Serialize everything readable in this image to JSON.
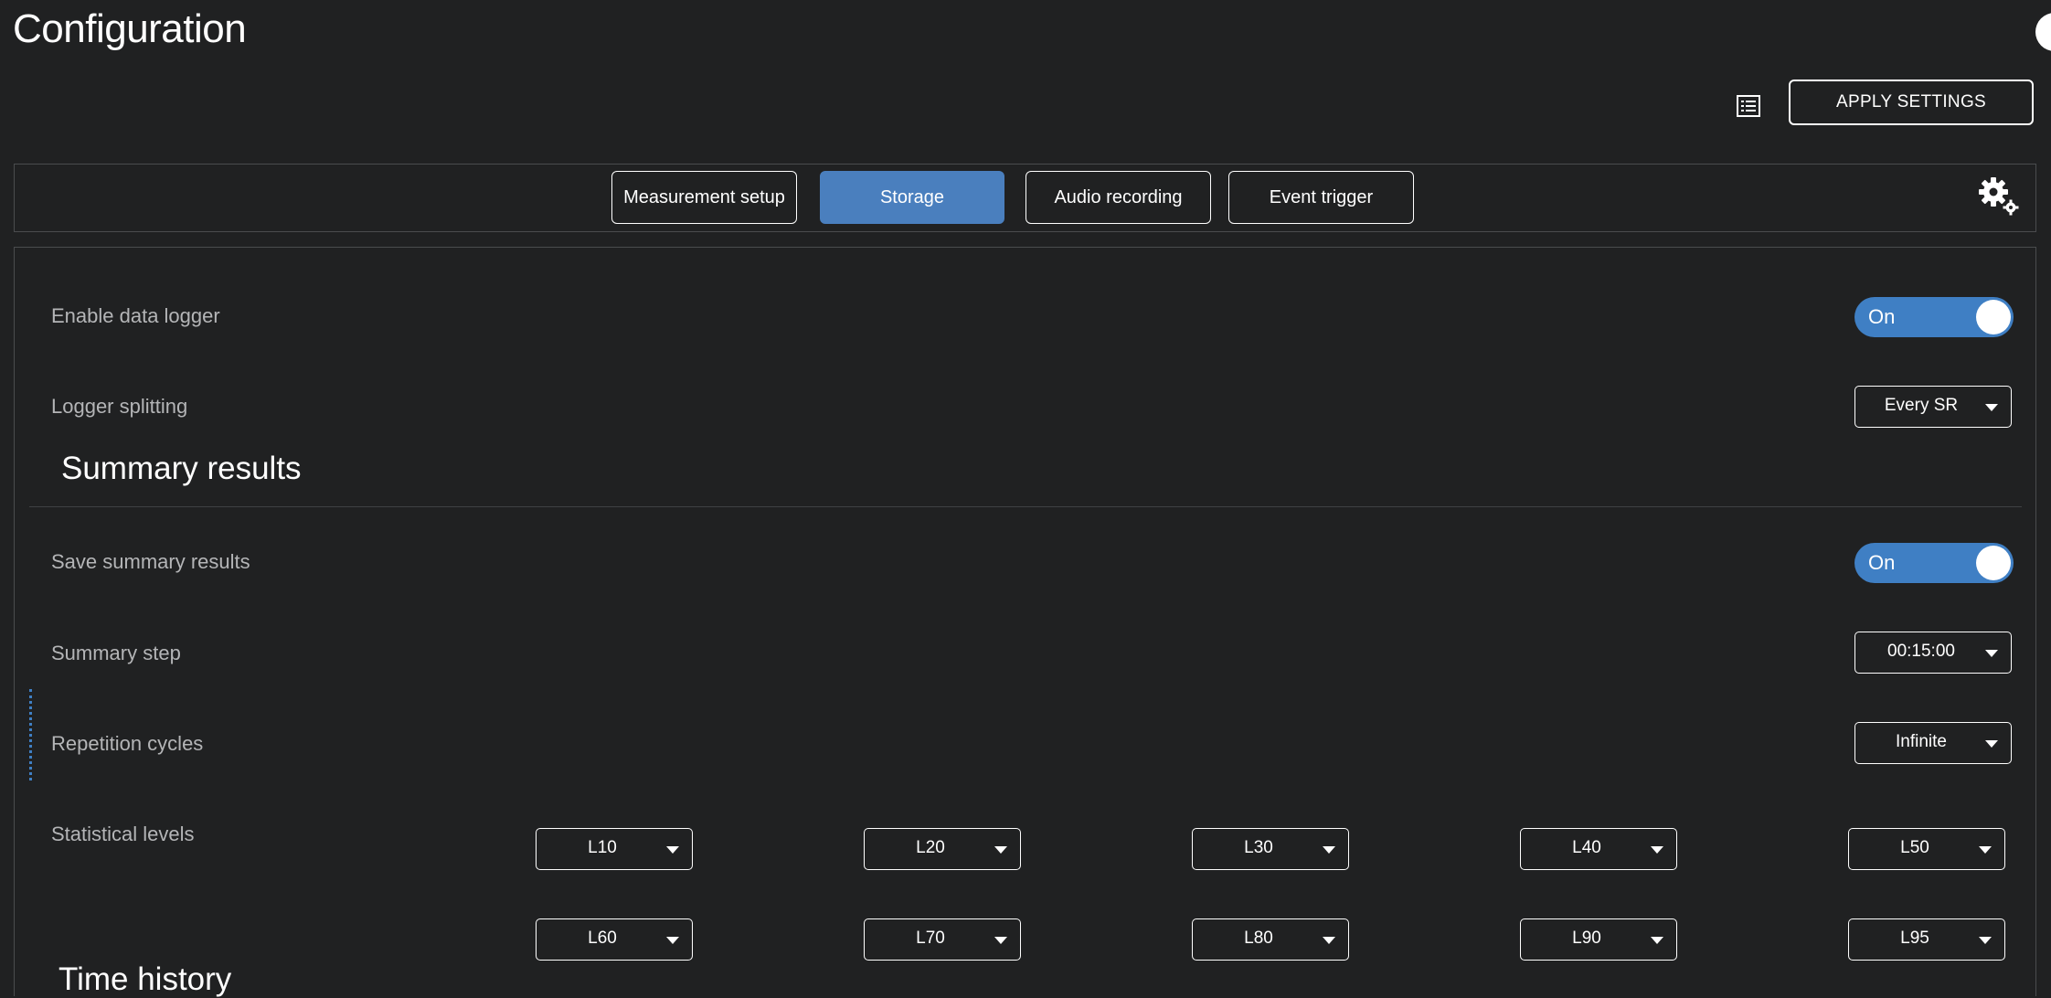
{
  "page": {
    "title": "Configuration"
  },
  "header": {
    "apply_label": "APPLY SETTINGS"
  },
  "tabs": [
    {
      "label": "Measurement setup",
      "active": false
    },
    {
      "label": "Storage",
      "active": true
    },
    {
      "label": "Audio recording",
      "active": false
    },
    {
      "label": "Event trigger",
      "active": false
    }
  ],
  "storage": {
    "enable_data_logger": {
      "label": "Enable data logger",
      "state": "On"
    },
    "logger_splitting": {
      "label": "Logger splitting",
      "value": "Every SR"
    }
  },
  "summary_results": {
    "title": "Summary results",
    "save_summary_results": {
      "label": "Save summary results",
      "state": "On"
    },
    "summary_step": {
      "label": "Summary step",
      "value": "00:15:00"
    },
    "repetition_cycles": {
      "label": "Repetition cycles",
      "value": "Infinite"
    },
    "statistical_levels": {
      "label": "Statistical levels",
      "values": [
        "L10",
        "L20",
        "L30",
        "L40",
        "L50",
        "L60",
        "L70",
        "L80",
        "L90",
        "L95"
      ]
    }
  },
  "next_section": {
    "title": "Time history"
  },
  "icons": [
    "list-icon",
    "gear-icon",
    "chevron-down-icon"
  ],
  "colors": {
    "accent": "#3f7fc4",
    "active_tab": "#4a7fbe",
    "background": "#202122",
    "label": "#b4b5b7"
  }
}
